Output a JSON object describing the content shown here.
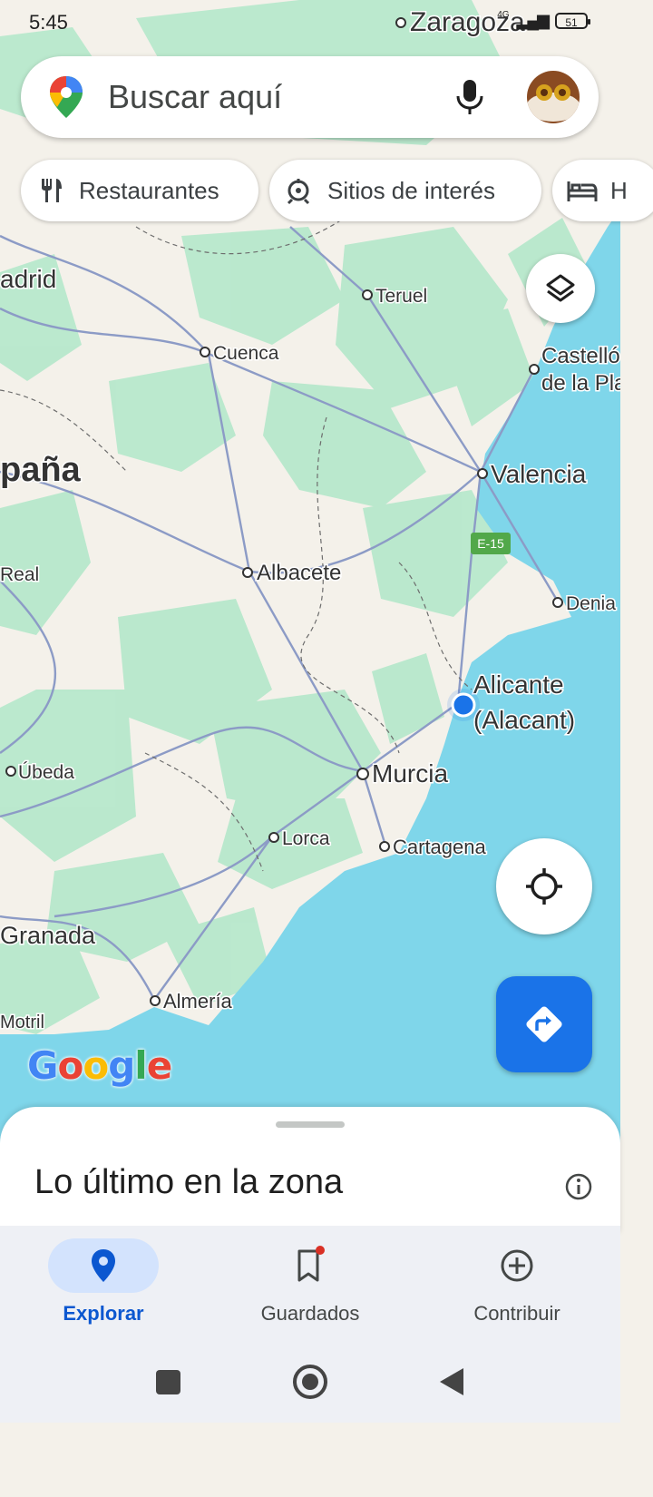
{
  "status_bar": {
    "time": "5:45",
    "network": "4G",
    "battery": "51"
  },
  "search": {
    "placeholder": "Buscar aquí"
  },
  "chips": [
    {
      "label": "Restaurantes",
      "icon": "fork-knife-icon"
    },
    {
      "label": "Sitios de interés",
      "icon": "landmark-icon"
    },
    {
      "label": "H",
      "icon": "bed-icon"
    }
  ],
  "map": {
    "labels": {
      "zaragoza": "Zaragoza",
      "teruel": "Teruel",
      "madrid": "adrid",
      "cuenca": "Cuenca",
      "castellon1": "Castelló",
      "castellon2": "de la Pla",
      "espana": "paña",
      "valencia": "Valencia",
      "e15": "E-15",
      "albacete": "Albacete",
      "real": "Real",
      "denia": "Denia",
      "alicante1": "Alicante",
      "alicante2": "(Alacant)",
      "ubeda": "Úbeda",
      "murcia": "Murcia",
      "lorca": "Lorca",
      "cartagena": "Cartagena",
      "granada": "Granada",
      "almeria": "Almería",
      "motril": "Motril",
      "google": "Google"
    }
  },
  "bottom_sheet": {
    "title": "Lo último en la zona"
  },
  "bottom_nav": [
    {
      "label": "Explorar",
      "active": true
    },
    {
      "label": "Guardados",
      "active": false
    },
    {
      "label": "Contribuir",
      "active": false
    }
  ],
  "colors": {
    "accent": "#1a73e8",
    "water": "#7fd6ea",
    "land": "#f4f1ea",
    "green": "#a9e4c3",
    "road": "#8c9bc6"
  }
}
